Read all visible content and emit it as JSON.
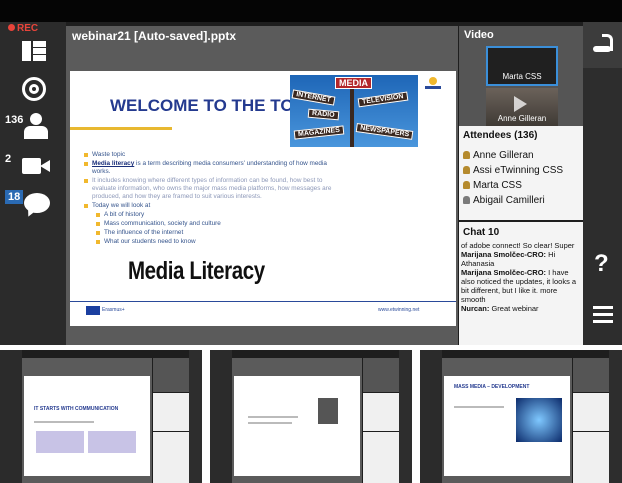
{
  "app": {
    "recording_label": "REC",
    "file_title": "webinar21 [Auto-saved].pptx"
  },
  "left_toolbar": {
    "attendee_count": "136",
    "camera_count": "2",
    "chat_count": "18"
  },
  "slide": {
    "heading": "WELCOME TO THE TOPIC!",
    "bullets": [
      {
        "text": "Waste topic"
      },
      {
        "lead": "Media literacy",
        "text": " is a term describing media consumers' understanding of how media works."
      },
      {
        "text": "It includes knowing where different types of information can be found, how best to evaluate information, who owns the major mass media platforms, how messages are produced, and how they are framed to suit various interests.",
        "dim": true
      },
      {
        "text": "Today we will look at"
      }
    ],
    "sub_bullets": [
      "A bit of history",
      "Mass communication, society and culture",
      "The influence of the internet",
      "What our students need to know"
    ],
    "overlay_title": "Media Literacy",
    "signs": [
      "MEDIA",
      "INTERNET",
      "TELEVISION",
      "RADIO",
      "MAGAZINES",
      "NEWSPAPERS"
    ],
    "footer_left": "Erasmus+",
    "footer_url": "www.etwinning.net"
  },
  "video": {
    "title": "Video",
    "feeds": [
      "Marta CSS",
      "Anne Gilleran"
    ]
  },
  "attendees": {
    "title": "Attendees",
    "count": "(136)",
    "list": [
      "Anne Gilleran",
      "Assi eTwinning CSS",
      "Marta CSS",
      "Abigail Camilleri"
    ]
  },
  "chat": {
    "title": "Chat",
    "count": "10",
    "messages": [
      {
        "author": "",
        "text": "of adobe connect! So clear! Super"
      },
      {
        "author": "Marijana Smolčec-CRO:",
        "text": "Hi Athanasia"
      },
      {
        "author": "Marijana Smolčec-CRO:",
        "text": "I have also noticed the updates, it looks a bit different, but I like it. more smooth"
      },
      {
        "author": "Nurcan:",
        "text": "Great webinar"
      }
    ]
  },
  "help_label": "?",
  "thumbnails": [
    {
      "heading": "IT STARTS WITH COMMUNICATION"
    },
    {
      "heading": ""
    },
    {
      "heading": "MASS MEDIA – DEVELOPMENT"
    }
  ],
  "colors": {
    "accent": "#2a6ab3",
    "rec": "#e8443a",
    "slide_heading": "#243a8f",
    "bullet": "#f1b82d"
  }
}
